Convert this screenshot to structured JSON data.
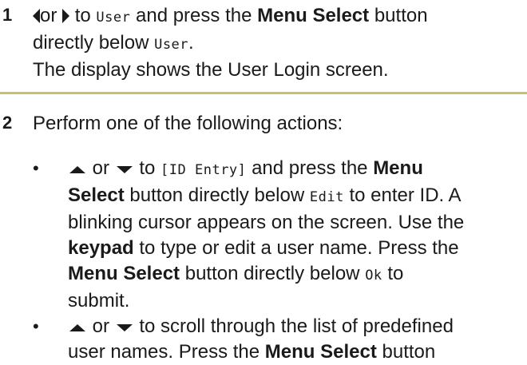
{
  "step1": {
    "number": "1",
    "or": "or",
    "to": "to",
    "target": "User",
    "press": "and press the",
    "button": "Menu Select",
    "after": "button",
    "line2_pre": "directly below",
    "line2_target": "User",
    "line2_end": ".",
    "line3": "The display shows the User Login screen."
  },
  "step2": {
    "number": "2",
    "intro": "Perform one of the following actions:",
    "bullet1": {
      "or": "or",
      "to": "to",
      "target": "[ID Entry]",
      "press": "and press the",
      "button": "Menu",
      "button2": "Select",
      "below": "button directly below",
      "edit": "Edit",
      "enter": "to enter ID. A",
      "line3": "blinking cursor appears on the screen. Use the",
      "keypad": "keypad",
      "line4": "to type or edit a user name. Press the",
      "menu_select": "Menu Select",
      "line5": "button directly below",
      "ok": "Ok",
      "to2": "to",
      "submit": "submit."
    },
    "bullet2": {
      "or": "or",
      "line1": "to scroll through the list of predefined",
      "line2": "user names. Press the",
      "button": "Menu Select",
      "after": "button"
    }
  },
  "colors": {
    "rule": "#c8c26a",
    "text": "#1a1a1a"
  }
}
